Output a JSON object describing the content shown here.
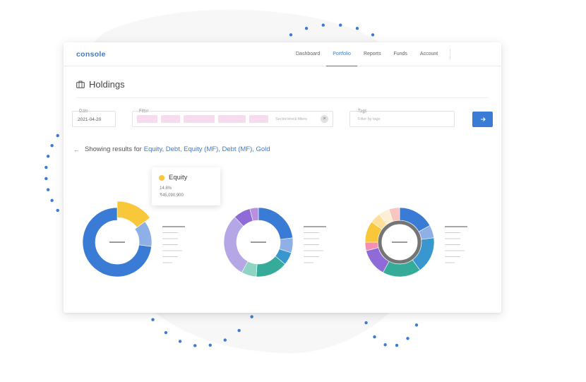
{
  "app": {
    "logo": "console"
  },
  "nav": [
    {
      "label": "Dashboard",
      "active": false
    },
    {
      "label": "Portfolio",
      "active": true
    },
    {
      "label": "Reports",
      "active": false
    },
    {
      "label": "Funds",
      "active": false
    },
    {
      "label": "Account",
      "active": false
    }
  ],
  "page": {
    "title": "Holdings",
    "title_icon": "briefcase-icon"
  },
  "filters": {
    "date_label": "Date",
    "date_value": "2021-04-20",
    "filter_label": "Filter",
    "filter_placeholder": "Sector/stock filters",
    "tags_label": "Tags",
    "tags_placeholder": "Filter by tags",
    "submit_icon": "arrow-right-icon"
  },
  "results": {
    "prefix": "Showing results for",
    "categories": "Equity, Debt, Equity (MF), Debt (MF), Gold"
  },
  "tooltip": {
    "name": "Equity",
    "percent": "14.8%",
    "amount": "₹45,090,900",
    "color": "#f8c73a"
  },
  "colors": {
    "accent": "#3a7bd5",
    "chip": "#f7dcf0",
    "dots": "#3a7bd5"
  },
  "chart_data": [
    {
      "type": "pie",
      "slices": [
        {
          "value": 14.8,
          "color": "#f8c73a",
          "highlighted": true
        },
        {
          "value": 12.2,
          "color": "#8fb0e6"
        },
        {
          "value": 73,
          "color": "#3a7bd5"
        }
      ]
    },
    {
      "type": "pie",
      "slices": [
        {
          "value": 23,
          "color": "#3a7bd5"
        },
        {
          "value": 7,
          "color": "#8fb0e6"
        },
        {
          "value": 6,
          "color": "#3997cf"
        },
        {
          "value": 15,
          "color": "#36ab9a"
        },
        {
          "value": 7,
          "color": "#8fd3c3"
        },
        {
          "value": 30,
          "color": "#b5a7e6"
        },
        {
          "value": 8,
          "color": "#8e6bd6"
        },
        {
          "value": 4,
          "color": "#b98fe0"
        }
      ]
    },
    {
      "type": "pie",
      "slices": [
        {
          "value": 17,
          "color": "#3a7bd5"
        },
        {
          "value": 6,
          "color": "#8fb0e6"
        },
        {
          "value": 17,
          "color": "#3997cf"
        },
        {
          "value": 18,
          "color": "#36ab9a"
        },
        {
          "value": 13,
          "color": "#8e6bd6"
        },
        {
          "value": 4,
          "color": "#f48fb1"
        },
        {
          "value": 10,
          "color": "#f8c73a"
        },
        {
          "value": 5,
          "color": "#fde09a"
        },
        {
          "value": 5,
          "color": "#fcefd6"
        },
        {
          "value": 5,
          "color": "#f9c5c0"
        }
      ],
      "inner_ring": {
        "color": "#757575"
      }
    }
  ]
}
